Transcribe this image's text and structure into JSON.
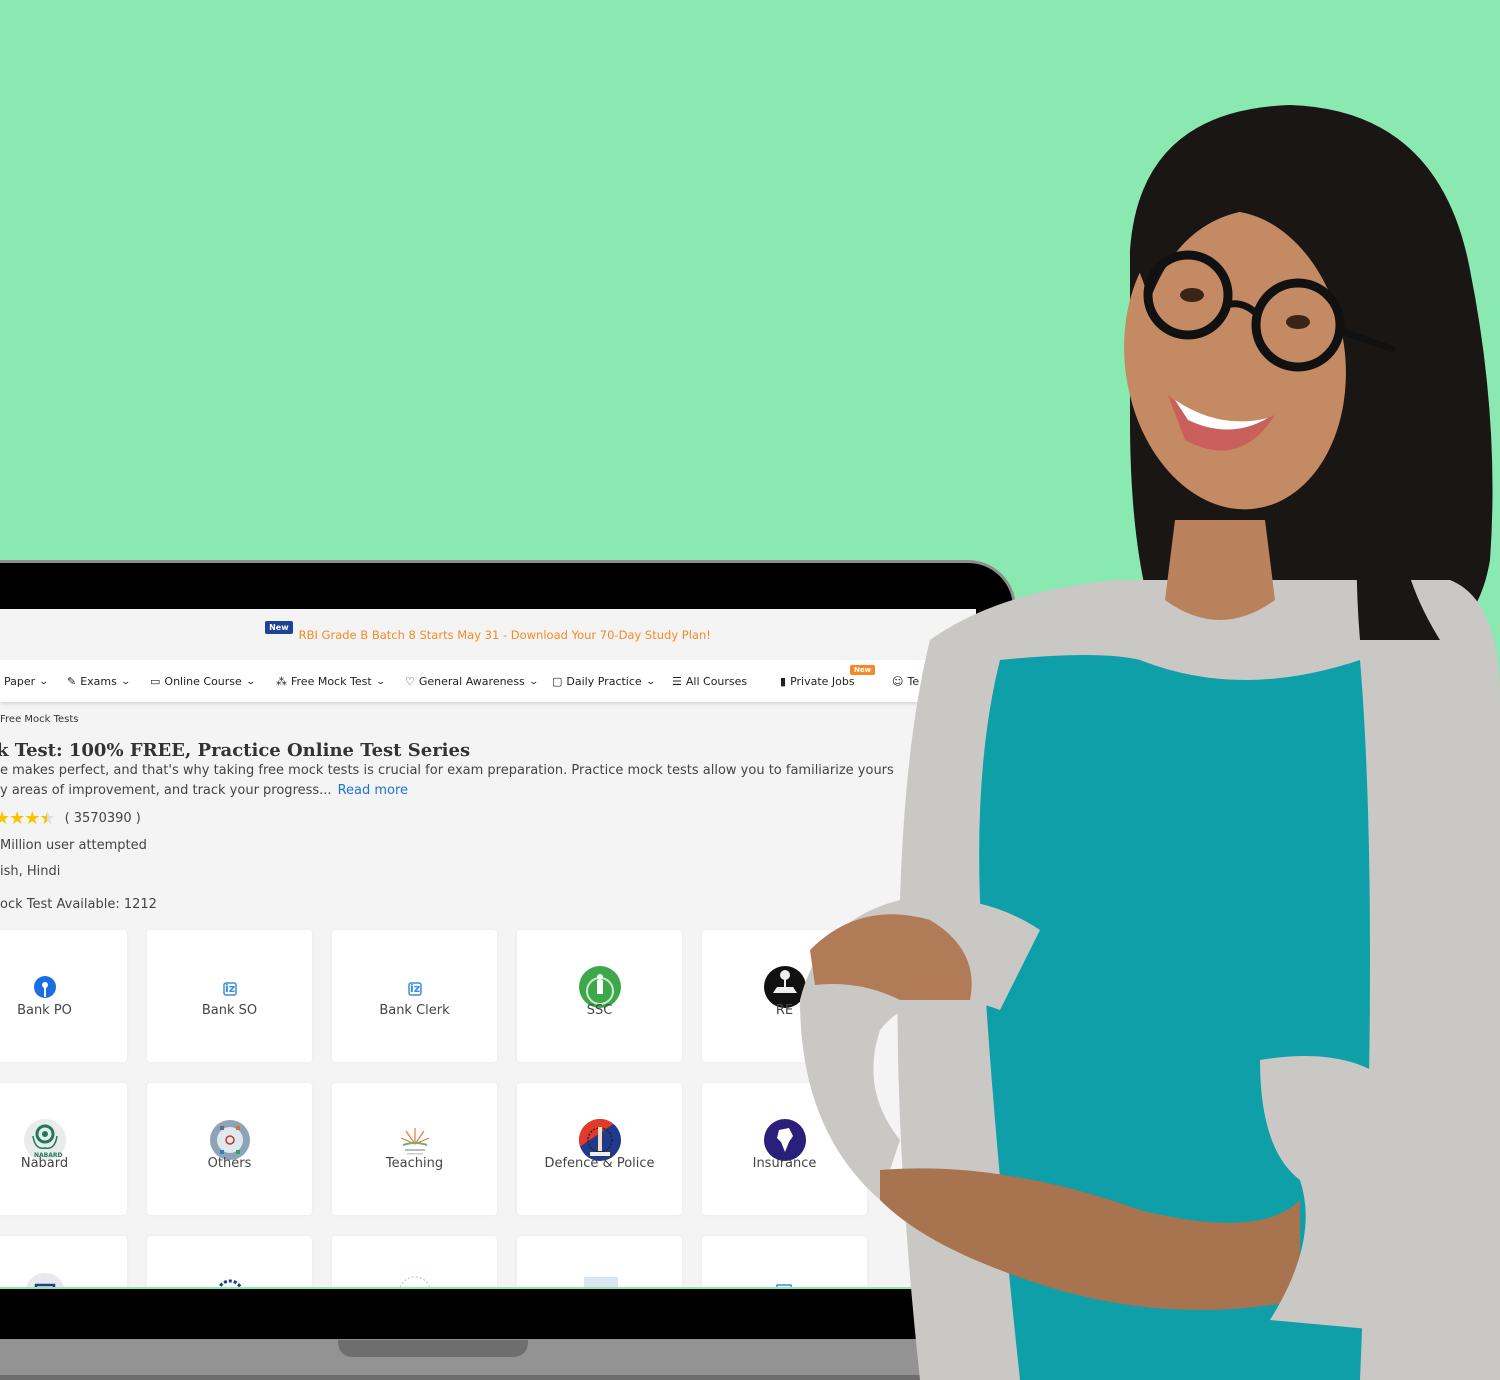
{
  "background_color": "#89e9b0",
  "announcement": {
    "badge": "New",
    "text": "RBI Grade B Batch 8 Starts May 31 - Download Your 70-Day Study Plan!",
    "text_color": "#f58a25",
    "badge_color": "#1d4494"
  },
  "nav": {
    "items": [
      {
        "icon": "paper-icon",
        "label": "Paper",
        "has_dropdown": true
      },
      {
        "icon": "edit-icon",
        "label": "Exams",
        "has_dropdown": true
      },
      {
        "icon": "laptop-icon",
        "label": "Online Course",
        "has_dropdown": true
      },
      {
        "icon": "cubes-icon",
        "label": "Free Mock Test",
        "has_dropdown": true
      },
      {
        "icon": "lightbulb-icon",
        "label": "General Awareness",
        "has_dropdown": true
      },
      {
        "icon": "note-icon",
        "label": "Daily Practice",
        "has_dropdown": true
      },
      {
        "icon": "list-icon",
        "label": "All Courses",
        "has_dropdown": false
      },
      {
        "icon": "briefcase-icon",
        "label": "Private Jobs",
        "has_dropdown": false,
        "badge": "New"
      },
      {
        "icon": "smile-icon",
        "label": "Te",
        "has_dropdown": false
      }
    ]
  },
  "breadcrumb": "Free Mock Tests",
  "page": {
    "title": "k Test: 100% FREE, Practice Online Test Series",
    "description_line1": "e makes perfect, and that's why taking free mock tests is crucial for exam preparation. Practice mock tests allow you to familiarize yours",
    "description_line2": "y areas of improvement, and track your progress...",
    "read_more": "Read more",
    "rating_value": 4.5,
    "rating_count": "( 3570390 )",
    "users_attempted": "Million user attempted",
    "languages": "ish, Hindi",
    "mock_tests_available": "ock Test Available: 1212"
  },
  "categories": [
    {
      "label": "Bank PO",
      "icon": "sbi-logo-icon"
    },
    {
      "label": "Bank SO",
      "icon": "ibps-logo-icon"
    },
    {
      "label": "Bank Clerk",
      "icon": "ibps-logo-icon"
    },
    {
      "label": "SSC",
      "icon": "ssc-logo-icon"
    },
    {
      "label": "RE",
      "icon": "rbi-logo-icon"
    },
    {
      "label": "Nabard",
      "icon": "nabard-logo-icon"
    },
    {
      "label": "Others",
      "icon": "others-logo-icon"
    },
    {
      "label": "Teaching",
      "icon": "teaching-logo-icon"
    },
    {
      "label": "Defence & Police",
      "icon": "police-logo-icon"
    },
    {
      "label": "Insurance",
      "icon": "insurance-logo-icon"
    },
    {
      "label": "",
      "icon": "partial-logo-icon"
    },
    {
      "label": "",
      "icon": "partial-logo-icon"
    },
    {
      "label": "",
      "icon": "partial-logo-icon"
    },
    {
      "label": "",
      "icon": "irdai-logo-icon"
    },
    {
      "label": "",
      "icon": "partial-logo-icon"
    }
  ]
}
